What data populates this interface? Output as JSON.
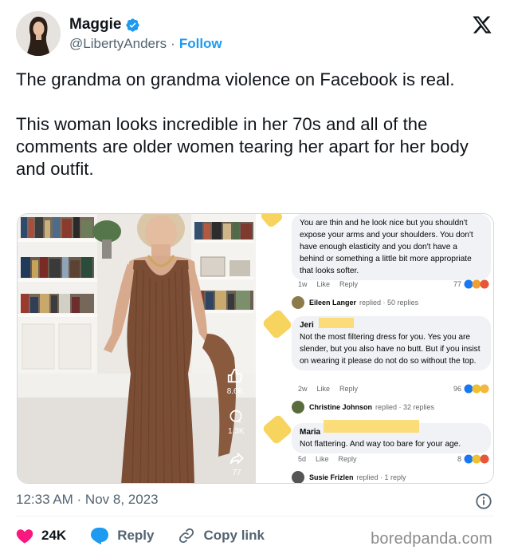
{
  "author": {
    "name": "Maggie",
    "handle": "@LibertyAnders",
    "separator": "·",
    "follow_label": "Follow",
    "verified": true
  },
  "tweet": {
    "paragraphs": [
      "The grandma on grandma violence on Facebook is real.",
      "This woman looks incredible in her 70s and all of the comments are older women tearing her apart for her body and outfit."
    ],
    "timestamp": "12:33 AM · Nov 8, 2023"
  },
  "video_overlay": {
    "like_count": "8.6K",
    "comment_count": "1.3K",
    "share_count": "77"
  },
  "facebook_comments": [
    {
      "author": "",
      "text": "You are thin and he look nice but you shouldn't expose your arms and your shoulders. You don't have enough elasticity and you don't have a behind or something a little bit more appropriate that looks softer.",
      "age": "1w",
      "like_label": "Like",
      "reply_label": "Reply",
      "reaction_count": "77"
    },
    {
      "author": "Jeri",
      "text": "Not the most filtering dress for you.  Yes you are slender, but you also have no butt.  But if you insist on wearing it please do not do so without the top.",
      "age": "2w",
      "like_label": "Like",
      "reply_label": "Reply",
      "reaction_count": "96"
    },
    {
      "author": "Maria",
      "text": "Not flattering. And way too bare for your age.",
      "age": "5d",
      "like_label": "Like",
      "reply_label": "Reply",
      "reaction_count": "8"
    }
  ],
  "reply_threads": [
    {
      "name": "Eileen Langer",
      "text": "replied · 50 replies"
    },
    {
      "name": "Christine Johnson",
      "text": "replied · 32 replies"
    },
    {
      "name": "Susie Frizlen",
      "text": "replied · 1 reply"
    }
  ],
  "actions": {
    "likes": "24K",
    "reply_label": "Reply",
    "copy_link_label": "Copy link"
  },
  "watermark": "boredpanda.com",
  "colors": {
    "accent": "#1d9bf0",
    "heart": "#f91880",
    "text_secondary": "#536471"
  }
}
